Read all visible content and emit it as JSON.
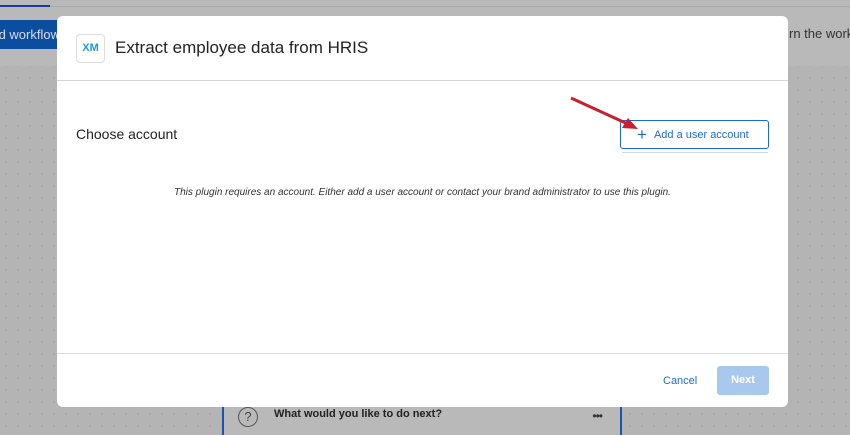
{
  "background": {
    "return_button": "Return to old workflow",
    "right_text": "rn the workflow",
    "card_title": "What would you like to do next?",
    "card_icon": "question-icon",
    "card_menu": "•••"
  },
  "modal": {
    "logo": "XM",
    "title": "Extract employee data from HRIS",
    "choose_label": "Choose account",
    "add_account_label": "Add a user account",
    "add_icon": "+",
    "info": "This plugin requires an account. Either add a user account or contact your brand administrator to use this plugin.",
    "cancel_label": "Cancel",
    "next_label": "Next"
  },
  "colors": {
    "accent": "#1a6bd0",
    "annotation_arrow": "#c8202e",
    "next_disabled": "#a9c8ee"
  }
}
